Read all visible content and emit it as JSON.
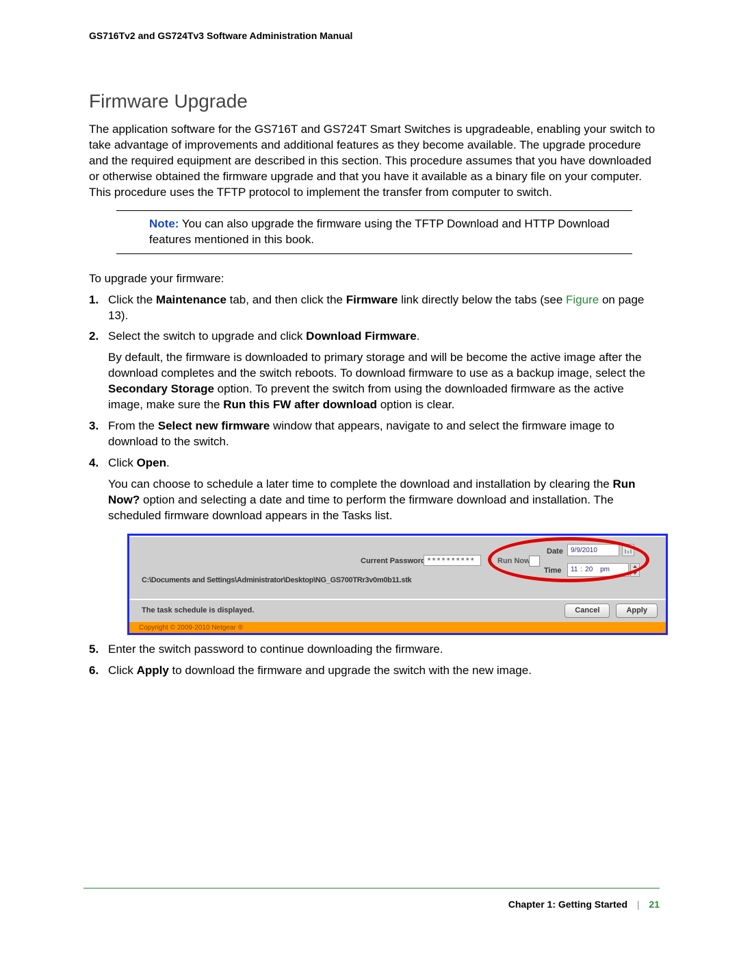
{
  "header": {
    "doc_title": "GS716Tv2 and GS724Tv3 Software Administration Manual"
  },
  "section": {
    "title": "Firmware Upgrade",
    "intro": "The application software for the GS716T and GS724T Smart Switches is upgradeable, enabling your switch to take advantage of improvements and additional features as they become available. The upgrade procedure and the required equipment are described in this section. This procedure assumes that you have downloaded or otherwise obtained the firmware upgrade and that you have it available as a binary file on your computer. This procedure uses the TFTP protocol to implement the transfer from computer to switch."
  },
  "note": {
    "label": "Note:",
    "text": "  You can also upgrade the firmware using the TFTP Download and HTTP Download features mentioned in this book."
  },
  "procedure": {
    "intro": "To upgrade your firmware:",
    "steps": {
      "s1_a": "Click the ",
      "s1_b": "Maintenance",
      "s1_c": " tab, and then click the ",
      "s1_d": "Firmware",
      "s1_e": " link directly below the tabs (see ",
      "s1_link": "Figure ",
      "s1_f": " on page 13).",
      "s2_a": "Select the switch to upgrade and click ",
      "s2_b": "Download Firmware",
      "s2_c": ".",
      "s2_follow_a": "By default, the firmware is downloaded to primary storage and will be become the active image after the download completes and the switch reboots. To download firmware to use as a backup image, select the ",
      "s2_follow_b": "Secondary Storage",
      "s2_follow_c": " option. To prevent the switch from using the downloaded firmware as the active image, make sure the ",
      "s2_follow_d": "Run this FW after download",
      "s2_follow_e": " option is clear.",
      "s3_a": "From the ",
      "s3_b": "Select new firmware",
      "s3_c": " window that appears, navigate to and select the firmware image to download to the switch.",
      "s4_a": "Click ",
      "s4_b": "Open",
      "s4_c": ".",
      "s4_follow_a": "You can choose to schedule a later time to complete the download and installation by clearing the ",
      "s4_follow_b": "Run Now?",
      "s4_follow_c": " option and selecting a date and time to perform the firmware download and installation. The scheduled firmware download appears in the Tasks list.",
      "s5": "Enter the switch password to continue downloading the firmware.",
      "s6_a": "Click ",
      "s6_b": "Apply",
      "s6_c": " to download the firmware and upgrade the switch with the new image."
    }
  },
  "figure": {
    "current_password_label": "Current Password:",
    "current_password_value": "**********",
    "run_now_label": "Run Now?",
    "filepath": "C:\\Documents and Settings\\Administrator\\Desktop\\NG_GS700TRr3v0m0b11.stk",
    "date_label": "Date",
    "date_value": "9/9/2010",
    "time_label": "Time",
    "time_hh": "11",
    "time_mm": "20",
    "time_ampm": "pm",
    "status_msg": "The task schedule is displayed.",
    "btn_cancel": "Cancel",
    "btn_apply": "Apply",
    "copyright": "Copyright © 2009-2010 Netgear ®"
  },
  "footer": {
    "chapter": "Chapter 1:  Getting Started",
    "sep": "|",
    "page": "21"
  }
}
